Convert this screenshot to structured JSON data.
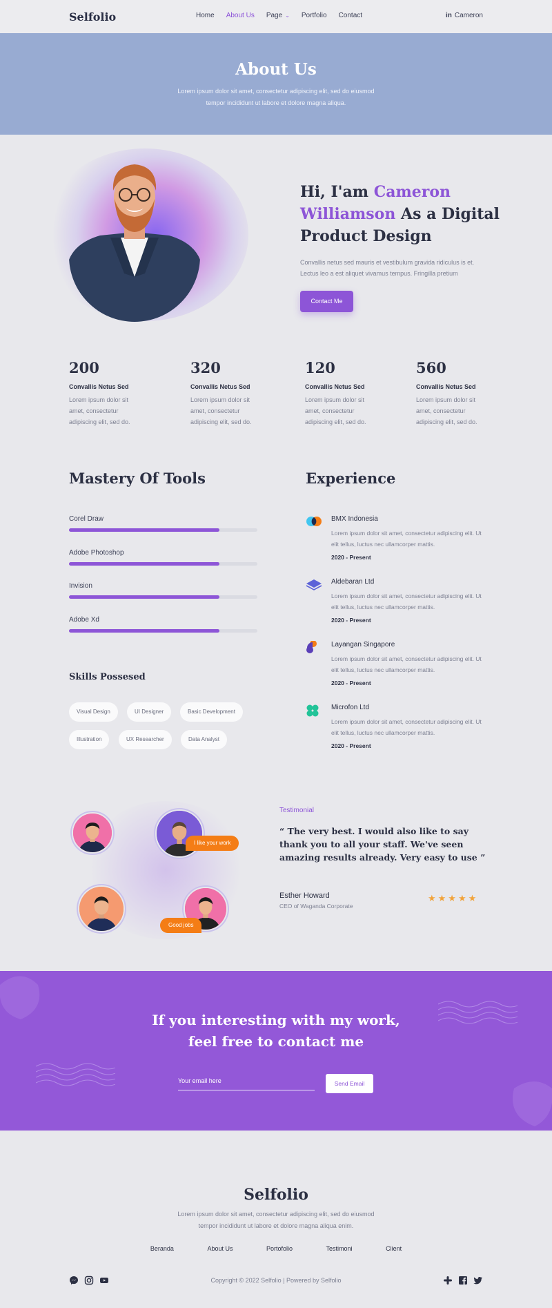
{
  "nav": {
    "logo": "Selfolio",
    "links": [
      "Home",
      "About Us",
      "Page",
      "Portfolio",
      "Contact"
    ],
    "user": "Cameron"
  },
  "hero": {
    "title": "About Us",
    "text": "Lorem ipsum dolor sit amet, consectetur adipiscing elit, sed do eiusmod tempor incididunt ut labore et dolore magna aliqua."
  },
  "intro": {
    "title_pre": "Hi, I'am ",
    "title_name": "Cameron Williamson",
    "title_post": " As a Digital Product Design",
    "text": "Convallis netus sed mauris et vestibulum gravida ridiculus is et. Lectus leo a est aliquet vivamus tempus. Fringilla pretium",
    "button": "Contact Me"
  },
  "stats": [
    {
      "value": "200",
      "label": "Convallis Netus Sed",
      "text": "Lorem ipsum dolor sit amet, consectetur adipiscing elit, sed do."
    },
    {
      "value": "320",
      "label": "Convallis Netus Sed",
      "text": "Lorem ipsum dolor sit amet, consectetur adipiscing elit, sed do."
    },
    {
      "value": "120",
      "label": "Convallis Netus Sed",
      "text": "Lorem ipsum dolor sit amet, consectetur adipiscing elit, sed do."
    },
    {
      "value": "560",
      "label": "Convallis Netus Sed",
      "text": "Lorem ipsum dolor sit amet, consectetur adipiscing elit, sed do."
    }
  ],
  "tools": {
    "title": "Mastery Of Tools",
    "items": [
      {
        "name": "Corel Draw",
        "level": 0.8
      },
      {
        "name": "Adobe Photoshop",
        "level": 0.8
      },
      {
        "name": "Invision",
        "level": 0.8
      },
      {
        "name": "Adobe Xd",
        "level": 0.8
      }
    ]
  },
  "skills": {
    "title": "Skills Possesed",
    "items": [
      "Visual Design",
      "UI Designer",
      "Basic Development",
      "Illustration",
      "UX Researcher",
      "Data Analyst"
    ]
  },
  "experience": {
    "title": "Experience",
    "items": [
      {
        "company": "BMX Indonesia",
        "text": "Lorem ipsum dolor sit amet, consectetur adipiscing elit. Ut elit tellus, luctus nec ullamcorper mattis.",
        "years": "2020 - Present",
        "icon": "bmx-logo-icon"
      },
      {
        "company": "Aldebaran Ltd",
        "text": "Lorem ipsum dolor sit amet, consectetur adipiscing elit. Ut elit tellus, luctus nec ullamcorper mattis.",
        "years": "2020 - Present",
        "icon": "layers-logo-icon"
      },
      {
        "company": "Layangan Singapore",
        "text": "Lorem ipsum dolor sit amet, consectetur adipiscing elit. Ut elit tellus, luctus nec ullamcorper mattis.",
        "years": "2020 - Present",
        "icon": "kite-logo-icon"
      },
      {
        "company": "Microfon Ltd",
        "text": "Lorem ipsum dolor sit amet, consectetur adipiscing elit. Ut elit tellus, luctus nec ullamcorper mattis.",
        "years": "2020 - Present",
        "icon": "clover-logo-icon"
      }
    ]
  },
  "testimonial": {
    "label": "Testimonial",
    "quote": "“ The very best. I would also like to say thank you to all your staff. We've seen amazing results already. Very easy to use ”",
    "name": "Esther Howard",
    "role": "CEO of Waganda Corporate",
    "stars": "★★★★★",
    "rating": 5,
    "bubble_1": "I like your work",
    "bubble_2": "Good jobs"
  },
  "contact": {
    "title_line1": "If you interesting with my work,",
    "title_line2": "feel free to contact me",
    "email_placeholder": "Your email here",
    "button": "Send Email"
  },
  "footer": {
    "logo": "Selfolio",
    "text": "Lorem ipsum dolor sit amet, consectetur adipiscing elit, sed do eiusmod tempor incididunt ut labore et dolore magna aliqua enim.",
    "links": [
      "Beranda",
      "About Us",
      "Portofolio",
      "Testimoni",
      "Client"
    ],
    "copyright": "Copyright © 2022 Selfolio | Powered by Selfolio",
    "social_left": [
      "messenger-icon",
      "instagram-icon",
      "youtube-icon"
    ],
    "social_right": [
      "slack-icon",
      "facebook-icon",
      "twitter-icon"
    ]
  },
  "colors": {
    "accent": "#8d55d7",
    "hero_bg": "#98abd2",
    "orange": "#f47d16",
    "star": "#f2a33a",
    "page_bg": "#e8e8ec"
  }
}
